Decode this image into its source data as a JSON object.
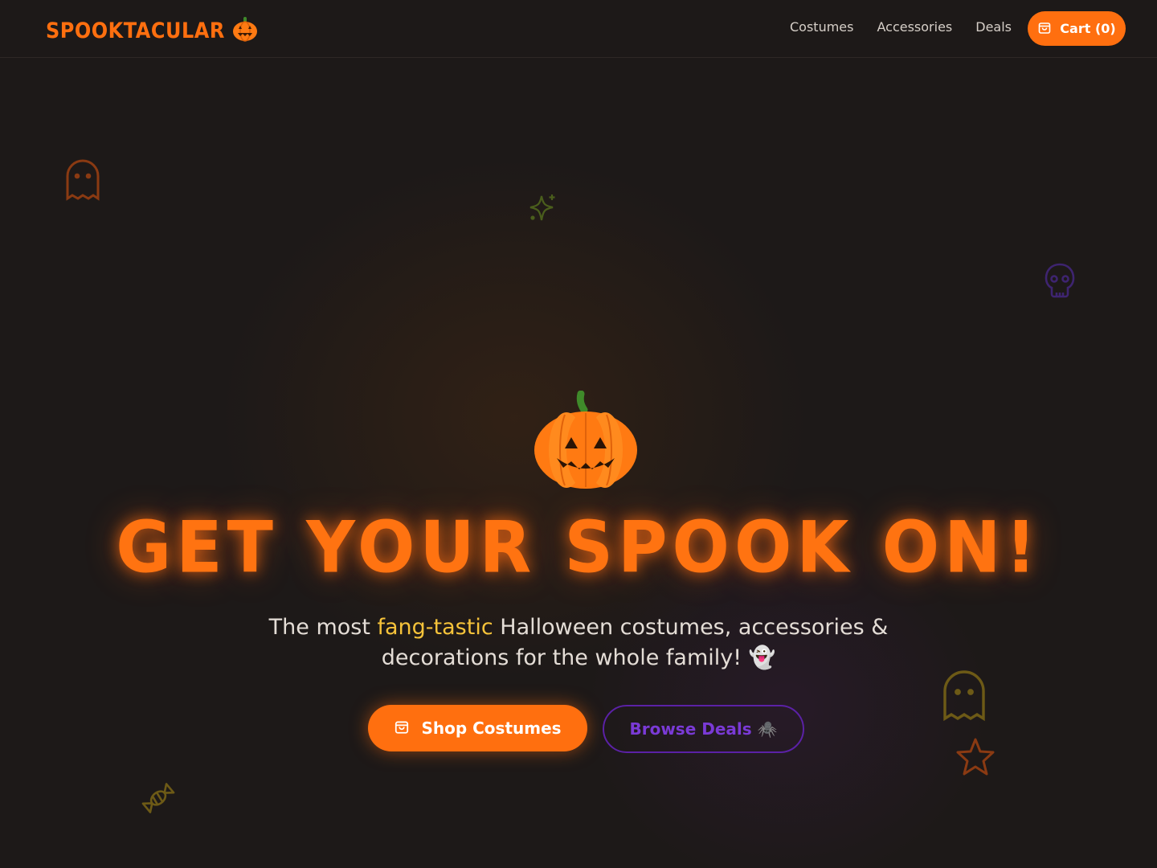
{
  "header": {
    "brand": "SPOOKTACULAR",
    "brand_icon": "pumpkin-icon",
    "nav": {
      "costumes": "Costumes",
      "accessories": "Accessories",
      "deals": "Deals"
    },
    "cart_label": "Cart (0)",
    "cart_icon": "shopping-bag-icon"
  },
  "hero": {
    "title": "GET YOUR SPOOK ON!",
    "subtitle_before": "The most ",
    "subtitle_highlight": "fang-tastic",
    "subtitle_after": " Halloween costumes, accessories & decorations for the whole family! 👻",
    "primary_button": "Shop Costumes",
    "secondary_button": "Browse Deals 🕷️"
  },
  "colors": {
    "accent": "#ff6f0f",
    "highlight": "#f6c33a",
    "secondary": "#5b21a6",
    "background": "#1d1918"
  },
  "decorations": [
    "ghost-icon",
    "sparkle-icon",
    "skull-icon",
    "ghost-icon",
    "star-icon",
    "candy-icon"
  ]
}
